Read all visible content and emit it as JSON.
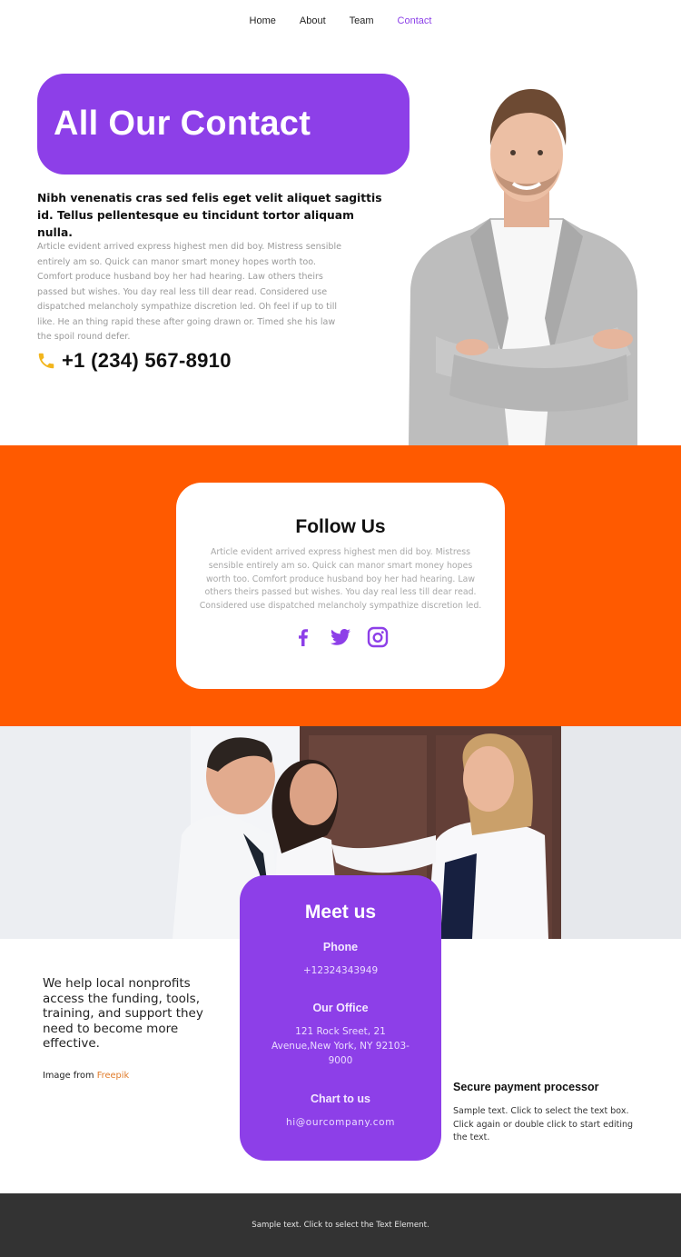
{
  "nav": {
    "items": [
      {
        "label": "Home",
        "active": false
      },
      {
        "label": "About",
        "active": false
      },
      {
        "label": "Team",
        "active": false
      },
      {
        "label": "Contact",
        "active": true
      }
    ]
  },
  "hero": {
    "title": "All Our Contact",
    "lead": "Nibh venenatis cras sed felis eget velit aliquet sagittis id. Tellus pellentesque eu tincidunt tortor aliquam nulla.",
    "body": "Article evident arrived express highest men did boy. Mistress sensible entirely am so. Quick can manor smart money hopes worth too. Comfort produce husband boy her had hearing. Law others theirs passed but wishes. You day real less till dear read. Considered use dispatched melancholy sympathize discretion led. Oh feel if up to till like. He an thing rapid these after going drawn or. Timed she his law the spoil round defer.",
    "phone": "+1 (234) 567-8910",
    "phone_icon": "phone-icon",
    "image_alt": "smiling man in grey blazer with crossed arms"
  },
  "follow": {
    "title": "Follow Us",
    "text": "Article evident arrived express highest men did boy. Mistress sensible entirely am so. Quick can manor smart money hopes worth too. Comfort produce husband boy her had hearing. Law others theirs passed but wishes. You day real less till dear read. Considered use dispatched melancholy sympathize discretion led.",
    "socials": [
      "facebook-icon",
      "twitter-icon",
      "instagram-icon"
    ]
  },
  "team_photo": {
    "alt": "three colleagues laughing in an office"
  },
  "meet": {
    "title": "Meet us",
    "phone_label": "Phone",
    "phone_value": "+12324343949",
    "office_label": "Our Office",
    "office_value": "121 Rock Sreet, 21 Avenue,New York, NY 92103-9000",
    "chat_label": "Chart to us",
    "chat_value": "hi@ourcompany.com"
  },
  "mission": {
    "text": "We help local nonprofits access the funding, tools, training, and support they need to become more effective.",
    "credit_prefix": "Image from ",
    "credit_link": "Freepik"
  },
  "secure": {
    "title": "Secure payment processor",
    "text": "Sample text. Click to select the text box. Click again or double click to start editing the text."
  },
  "footer": {
    "text": "Sample text. Click to select the Text Element."
  },
  "colors": {
    "purple": "#8d3fe8",
    "orange": "#ff5a00",
    "phone_icon": "#f2b51d",
    "footer_bg": "#333333",
    "link_orange": "#e07b2a"
  }
}
